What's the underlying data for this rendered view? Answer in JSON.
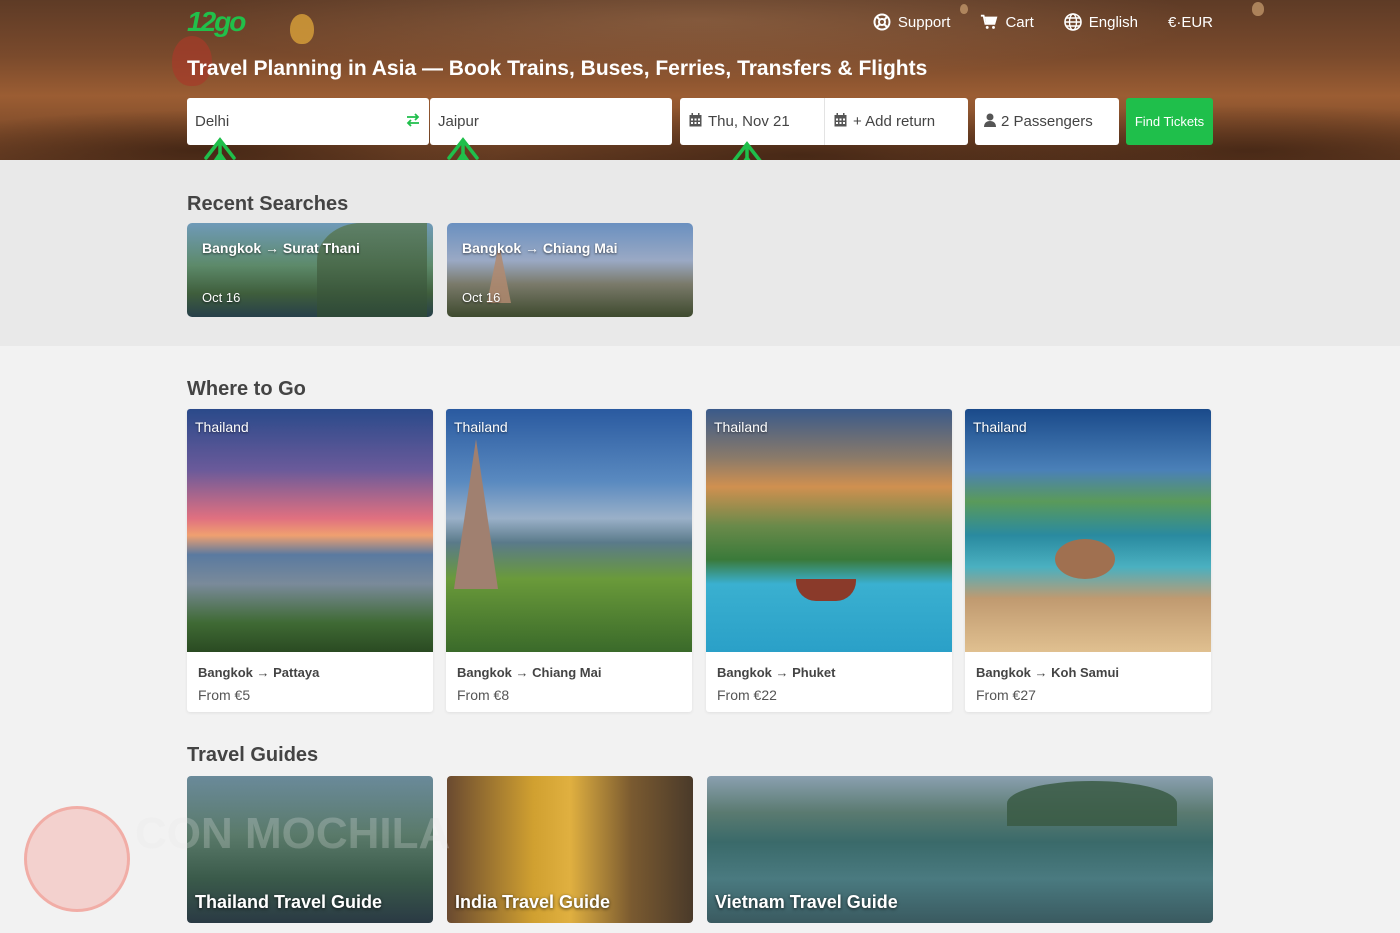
{
  "nav": {
    "support": "Support",
    "cart": "Cart",
    "language": "English",
    "currency": "€·EUR"
  },
  "logo_text": "12go",
  "hero": {
    "title": "Travel Planning in Asia — Book Trains, Buses, Ferries, Transfers & Flights"
  },
  "search": {
    "from": "Delhi",
    "to": "Jaipur",
    "date": "Thu, Nov 21",
    "return": "+ Add return",
    "passengers": "2 Passengers",
    "find": "Find Tickets"
  },
  "recent": {
    "title": "Recent Searches",
    "items": [
      {
        "route": "Bangkok → Surat Thani",
        "date": "Oct 16"
      },
      {
        "route": "Bangkok → Chiang Mai",
        "date": "Oct 16"
      }
    ]
  },
  "where": {
    "title": "Where to Go",
    "items": [
      {
        "country": "Thailand",
        "route": "Bangkok → Pattaya",
        "price": "From €5"
      },
      {
        "country": "Thailand",
        "route": "Bangkok → Chiang Mai",
        "price": "From €8"
      },
      {
        "country": "Thailand",
        "route": "Bangkok → Phuket",
        "price": "From €22"
      },
      {
        "country": "Thailand",
        "route": "Bangkok → Koh Samui",
        "price": "From €27"
      }
    ]
  },
  "guides": {
    "title": "Travel Guides",
    "items": [
      {
        "label": "Thailand Travel Guide"
      },
      {
        "label": "India Travel Guide"
      },
      {
        "label": "Vietnam Travel Guide"
      }
    ]
  },
  "watermark": "CON MOCHILA",
  "colors": {
    "accent": "#1fbf4b",
    "arrow": "#1fbf4b"
  }
}
